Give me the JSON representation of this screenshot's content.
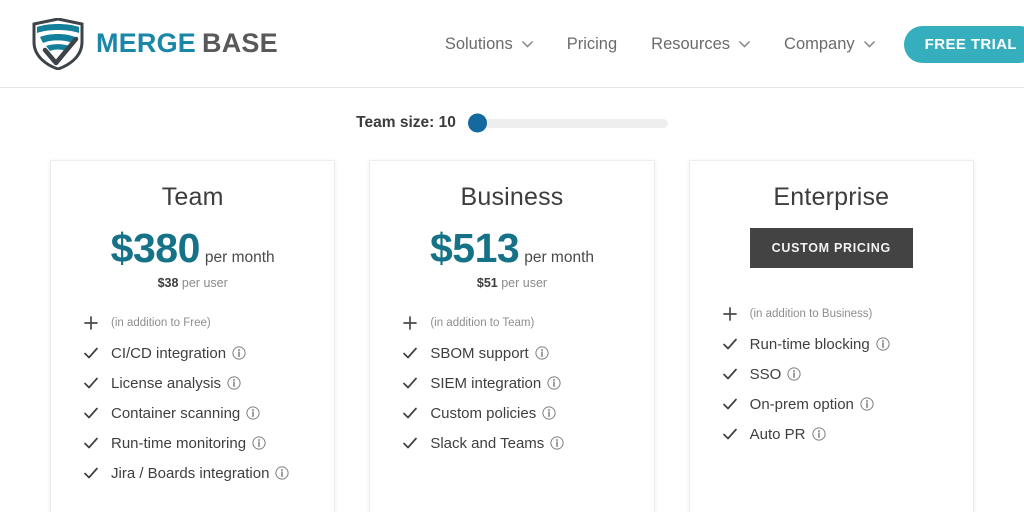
{
  "header": {
    "brand": {
      "part1": "MERGE",
      "part2": "BASE",
      "shield_icon": "shield-logo-icon"
    },
    "nav": [
      {
        "label": "Solutions",
        "has_chevron": true
      },
      {
        "label": "Pricing",
        "has_chevron": false
      },
      {
        "label": "Resources",
        "has_chevron": true
      },
      {
        "label": "Company",
        "has_chevron": true
      }
    ],
    "cta_label": "FREE TRIAL"
  },
  "slider": {
    "label": "Team size: 10",
    "value": 10,
    "handle_color": "#14699e",
    "track_color": "#eeeeee"
  },
  "cards": [
    {
      "title": "Team",
      "price": "$380",
      "period": "per month",
      "per_user_amount": "$38",
      "per_user_suffix": "per user",
      "note": "(in addition to Free)",
      "features": [
        "CI/CD integration",
        "License analysis",
        "Container scanning",
        "Run-time monitoring",
        "Jira / Boards integration"
      ]
    },
    {
      "title": "Business",
      "price": "$513",
      "period": "per month",
      "per_user_amount": "$51",
      "per_user_suffix": "per user",
      "note": "(in addition to Team)",
      "features": [
        "SBOM support",
        "SIEM integration",
        "Custom policies",
        "Slack and Teams"
      ]
    },
    {
      "title": "Enterprise",
      "custom_pricing_label": "CUSTOM PRICING",
      "note": "(in addition to Business)",
      "features": [
        "Run-time blocking",
        "SSO",
        "On-prem option",
        "Auto PR"
      ]
    }
  ],
  "colors": {
    "brand_teal": "#1a86a8",
    "brand_gray": "#59595b",
    "price_teal": "#167387",
    "cta_teal": "#35afbd",
    "dark_button": "#434343"
  }
}
